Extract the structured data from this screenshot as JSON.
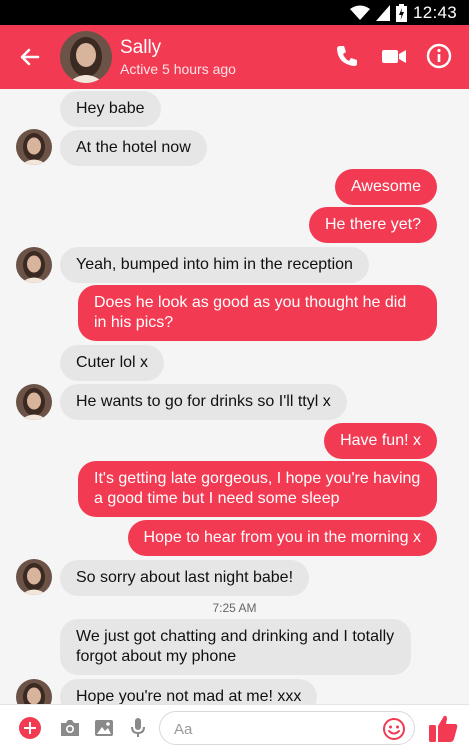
{
  "status_bar": {
    "time": "12:43"
  },
  "header": {
    "contact_name": "Sally",
    "presence": "Active 5 hours ago"
  },
  "messages": [
    {
      "dir": "in",
      "text": "Hey babe"
    },
    {
      "dir": "in",
      "text": "At the hotel now"
    },
    {
      "dir": "out",
      "text": "Awesome"
    },
    {
      "dir": "out",
      "text": "He there yet?"
    },
    {
      "dir": "in",
      "text": "Yeah, bumped into him in the reception"
    },
    {
      "dir": "out",
      "text": "Does he look as good as you thought he did in his pics?"
    },
    {
      "dir": "in",
      "text": "Cuter lol x"
    },
    {
      "dir": "in",
      "text": "He wants to go for drinks so I'll ttyl x"
    },
    {
      "dir": "out",
      "text": "Have fun! x"
    },
    {
      "dir": "out",
      "text": "It's getting late gorgeous, I hope you're having a good time but I need some sleep"
    },
    {
      "dir": "out",
      "text": "Hope to hear from you in the morning x"
    },
    {
      "dir": "in",
      "text": "So sorry about last night babe!"
    },
    {
      "dir": "in",
      "text": "We just got chatting and drinking and I totally forgot about my phone"
    },
    {
      "dir": "in",
      "text": "Hope you're not mad at me! xxx"
    }
  ],
  "timestamp": "7:25 AM",
  "composer": {
    "placeholder": "Aa"
  },
  "colors": {
    "accent": "#f23a52",
    "incoming_bubble": "#e6e6e6",
    "chat_bg": "#f5f5f5"
  }
}
